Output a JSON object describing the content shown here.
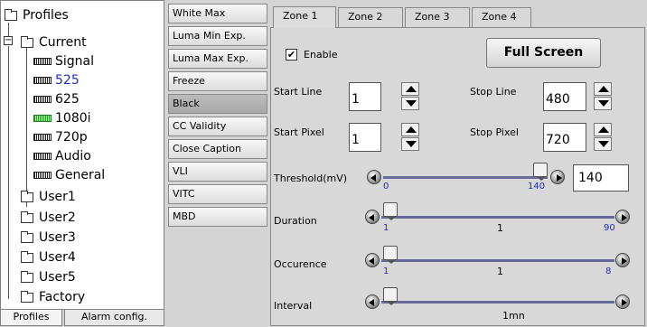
{
  "tree": {
    "root": "Profiles",
    "current": "Current",
    "children": [
      "Signal",
      "525",
      "625",
      "1080i",
      "720p",
      "Audio",
      "General"
    ],
    "users": [
      "User1",
      "User2",
      "User3",
      "User4",
      "User5",
      "Factory"
    ],
    "selected": "525",
    "expander_symbol": "−"
  },
  "bottom_tabs": [
    "Profiles",
    "Alarm config."
  ],
  "categories": [
    "White Max",
    "Luma Min Exp.",
    "Luma Max Exp.",
    "Freeze",
    "Black",
    "CC Validity",
    "Close Caption",
    "VLI",
    "VITC",
    "MBD"
  ],
  "active_category": "Black",
  "zone_tabs": [
    "Zone 1",
    "Zone 2",
    "Zone 3",
    "Zone 4"
  ],
  "active_zone": "Zone 1",
  "enable": {
    "label": "Enable",
    "checked": true,
    "mark": "✔"
  },
  "full_screen_label": "Full Screen",
  "start_line": {
    "label": "Start Line",
    "value": "1"
  },
  "stop_line": {
    "label": "Stop Line",
    "value": "480"
  },
  "start_pixel": {
    "label": "Start Pixel",
    "value": "1"
  },
  "stop_pixel": {
    "label": "Stop Pixel",
    "value": "720"
  },
  "threshold": {
    "label": "Threshold(mV)",
    "min": "0",
    "current": "140",
    "box_value": "140",
    "level": 1.0
  },
  "duration": {
    "label": "Duration",
    "min": "1",
    "mid": "1",
    "max": "90",
    "level": 0.0
  },
  "occurence": {
    "label": "Occurence",
    "min": "1",
    "mid": "1",
    "max": "8",
    "level": 0.0
  },
  "interval": {
    "label": "Interval",
    "mid": "1mn",
    "level": 0.0
  }
}
